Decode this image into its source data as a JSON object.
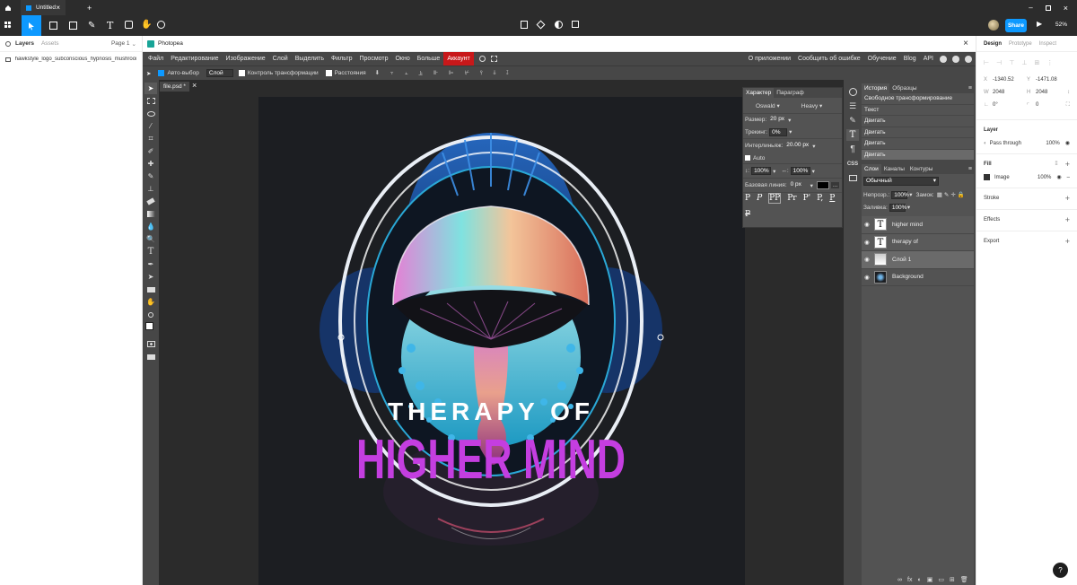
{
  "figma": {
    "tab_title": "Untitled",
    "page_label": "Page 1",
    "panel_tabs_left": [
      "Layers",
      "Assets"
    ],
    "layer_item": "hawkstyle_logo_subconscious_hypnosis_mushrooms...",
    "share_label": "Share",
    "zoom": "52%",
    "right_tabs": [
      "Design",
      "Prototype",
      "Inspect"
    ],
    "props": {
      "x_label": "X",
      "x": "-1340.52",
      "y_label": "Y",
      "y": "-1471.08",
      "w_label": "W",
      "w": "2048",
      "h_label": "H",
      "h": "2048",
      "rotation": "0°",
      "radius": "0"
    },
    "layer_section": "Layer",
    "blend": "Pass through",
    "opacity": "100%",
    "fill_section": "Fill",
    "fill_type": "Image",
    "fill_opacity": "100%",
    "stroke_section": "Stroke",
    "effects_section": "Effects",
    "export_section": "Export",
    "help": "?"
  },
  "plugin": {
    "name": "Photopea",
    "close": "×"
  },
  "pp": {
    "menu": [
      "Файл",
      "Редактирование",
      "Изображение",
      "Слой",
      "Выделить",
      "Фильтр",
      "Просмотр",
      "Окно",
      "Больше",
      "Аккаунт"
    ],
    "menu_right": [
      "О приложении",
      "Сообщить об ошибке",
      "Обучение",
      "Blog",
      "API"
    ],
    "options": {
      "autoselect": "Авто-выбор",
      "layer_mode": "Слой",
      "transform": "Контроль трансформации",
      "distances": "Расстояния"
    },
    "doc_tab": "file.psd *",
    "doc_close": "×",
    "character": {
      "tabs": [
        "Характер",
        "Параграф"
      ],
      "font": "Oswald",
      "weight": "Heavy",
      "size_label": "Размер:",
      "size": "20 px",
      "tracking_label": "Трекинг:",
      "tracking": "0%",
      "leading_label": "Интерлиньяж:",
      "leading": "20.00 px",
      "auto_label": "Auto",
      "vscale_label": "↕:",
      "vscale": "100%",
      "hscale_label": "↔:",
      "hscale": "100%",
      "baseline_label": "Базовая линия:",
      "baseline": "0 px",
      "more": "...",
      "style_glyphs": [
        "P",
        "P",
        "PP",
        "Pr",
        "P'",
        "P,",
        "P",
        "P"
      ]
    },
    "history": {
      "tabs": [
        "История",
        "Образцы"
      ],
      "items": [
        "Свободное трансформирование",
        "Текст",
        "Двигать",
        "Двигать",
        "Двигать",
        "Двигать"
      ]
    },
    "layers_panel": {
      "tabs": [
        "Слои",
        "Каналы",
        "Контуры"
      ],
      "blend": "Обычный",
      "opacity_label": "Непрозр.:",
      "opacity": "100%",
      "lock_label": "Замок:",
      "fill_label": "Заливка:",
      "fill": "100%",
      "layers": [
        {
          "name": "higher mind",
          "thumb": "T"
        },
        {
          "name": "therapy of",
          "thumb": "T"
        },
        {
          "name": "Слой 1",
          "thumb": ""
        },
        {
          "name": "Background",
          "thumb": ""
        }
      ]
    },
    "css_label": "CSS"
  },
  "artwork": {
    "line1": "THERAPY OF",
    "line2": "HIGHER MIND"
  },
  "colors": {
    "accent": "#0d99ff",
    "pp_red": "#c8181a",
    "magenta": "#c43ee0",
    "canvas": "#1c1e22"
  }
}
